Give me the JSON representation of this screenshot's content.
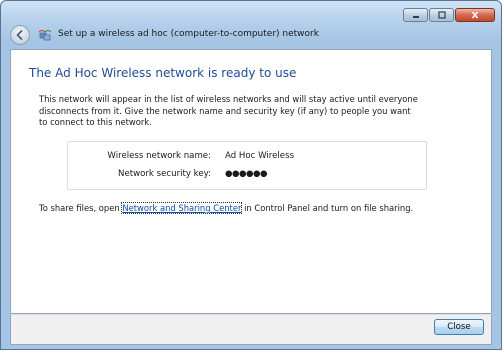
{
  "window": {
    "title": "Set up a wireless ad hoc (computer-to-computer) network",
    "icons": {
      "back": "back-arrow-icon",
      "wizard": "wireless-network-icon",
      "minimize": "minimize-icon",
      "maximize": "maximize-icon",
      "close": "close-icon"
    }
  },
  "main": {
    "heading": "The Ad Hoc Wireless network is ready to use",
    "description": "This network will appear in the list of wireless networks and will stay active until everyone disconnects from it. Give the network name and security key (if any) to people you want to connect to this network.",
    "details": {
      "network_name_label": "Wireless network name:",
      "network_name_value": "Ad Hoc Wireless",
      "security_key_label": "Network security key:",
      "security_key_value": "●●●●●●"
    },
    "share": {
      "prefix": "To share files, open ",
      "link": "Network and Sharing Center",
      "suffix": " in Control Panel and turn on file sharing."
    }
  },
  "footer": {
    "close_label": "Close"
  },
  "colors": {
    "heading": "#1e4b96",
    "link": "#0b4fa8",
    "chrome": "#a6c4e3"
  }
}
